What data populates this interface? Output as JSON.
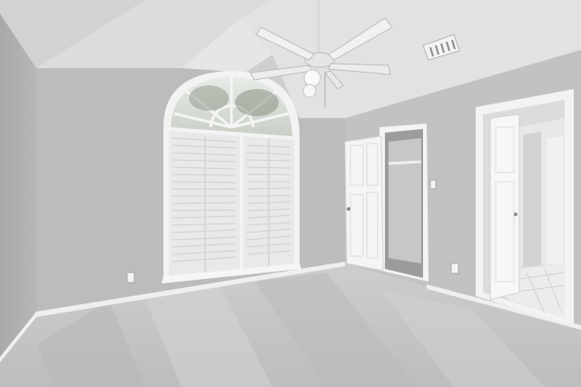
{
  "scene": {
    "kind": "interior-photo",
    "room": "empty bedroom",
    "colors": {
      "wall": "#b9b9b9",
      "wall_light": "#c9c9c9",
      "ceiling": "#dadada",
      "carpet": "#c4c4c4",
      "trim": "#f2f2f2",
      "door": "#f4f4f4"
    },
    "elements": [
      "vaulted-ceiling",
      "ceiling-fan",
      "air-vent",
      "arched-window",
      "plantation-shutters",
      "closet-door",
      "bathroom-door",
      "baseboard",
      "carpet",
      "outlets",
      "light-switch"
    ]
  }
}
